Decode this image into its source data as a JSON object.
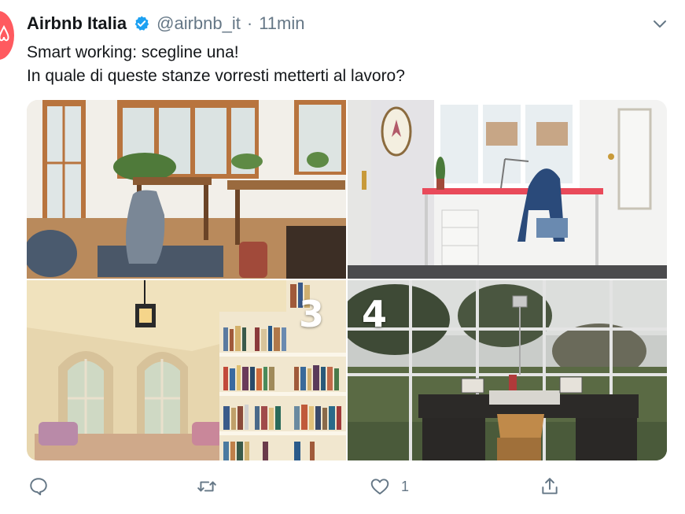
{
  "tweet": {
    "author_name": "Airbnb Italia",
    "handle": "@airbnb_it",
    "separator": "·",
    "time": "11min",
    "line1": "Smart working: scegline una!",
    "line2": "In quale di queste stanze vorresti metterti al lavoro?",
    "photos": [
      {
        "label": ""
      },
      {
        "label": ""
      },
      {
        "label": "3"
      },
      {
        "label": "4"
      }
    ],
    "actions": {
      "reply_count": "",
      "retweet_count": "",
      "like_count": "1"
    }
  },
  "icons": {
    "verified": "verified-badge-icon",
    "caret": "chevron-down-icon",
    "reply": "reply-icon",
    "retweet": "retweet-icon",
    "like": "heart-icon",
    "share": "share-icon"
  },
  "colors": {
    "brand": "#ff5a5f",
    "verified": "#1da1f2",
    "muted": "#657786"
  }
}
